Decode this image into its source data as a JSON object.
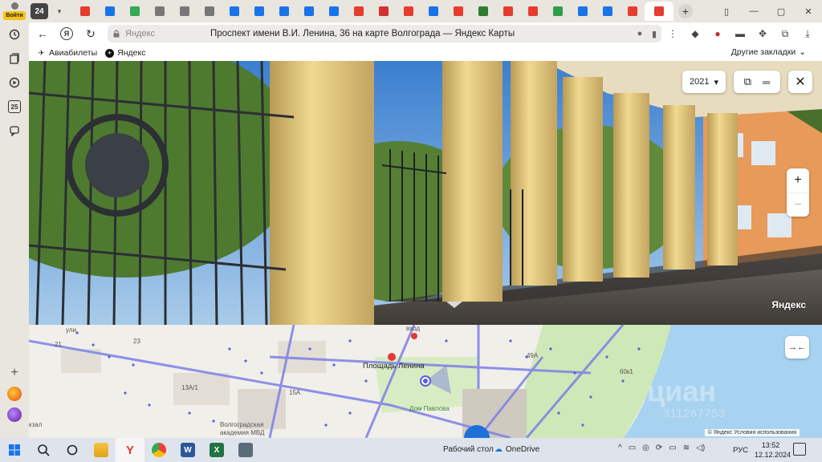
{
  "sidebar": {
    "login_label": "Войти",
    "badge_number": "25"
  },
  "tabs": {
    "count": "24",
    "favicons": [
      "#e43d2f",
      "#1a73e8",
      "#34a853",
      "#777",
      "#777",
      "#777",
      "#1a73e8",
      "#1a73e8",
      "#1a73e8",
      "#1a73e8",
      "#1a73e8",
      "#e43d2f",
      "#d32f2f",
      "#e43d2f",
      "#1a73e8",
      "#e43d2f",
      "#2e7d32",
      "#e43d2f",
      "#e43d2f",
      "#2e9e4e",
      "#1a73e8",
      "#1a73e8",
      "#e43d2f",
      "#e43d2f"
    ]
  },
  "navbar": {
    "domain": "Яндекс",
    "page_title": "Проспект имени В.И. Ленина, 36 на карте Волгограда — Яндекс Карты"
  },
  "bookmarks": {
    "items": [
      {
        "label": "Авиабилеты",
        "icon": "plane-icon"
      },
      {
        "label": "Яндекс",
        "icon": "plus-circle-icon"
      }
    ],
    "other": "Другие закладки"
  },
  "panorama": {
    "year": "2021",
    "watermark": "Яндекс"
  },
  "map": {
    "labels": {
      "square": "Площадь Ленина",
      "pavlov": "Дом Павлова",
      "academy_1": "Волгоградская",
      "academy_2": "академия МВД",
      "entrance": "вход",
      "n23": "23",
      "n13a1": "13А/1",
      "n15a": "15А",
      "n49a": "49А",
      "n60": "60к1",
      "n21": "21",
      "vokzal": "кзал",
      "street": "ули"
    },
    "copyright": "© Яндекс   Условия использования",
    "watermark": "циан",
    "watermark_id": "311267753"
  },
  "taskbar": {
    "desktop": "Рабочий стол",
    "onedrive": "OneDrive",
    "lang": "РУС",
    "time": "13:52",
    "date": "12.12.2024"
  }
}
